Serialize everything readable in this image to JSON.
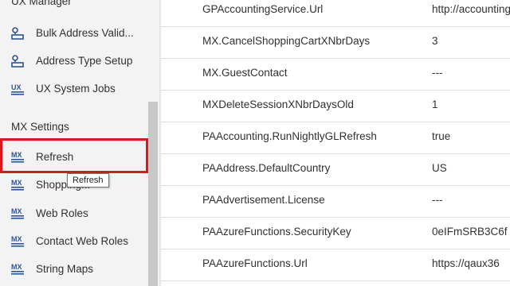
{
  "sidebar": {
    "ux_section_title": "UX Manager",
    "ux_items": [
      {
        "label": "Bulk Address Valid...",
        "icon": "address-icon"
      },
      {
        "label": "Address Type Setup",
        "icon": "address-icon"
      },
      {
        "label": "UX System Jobs",
        "icon": "ux-icon"
      }
    ],
    "mx_section_title": "MX Settings",
    "mx_items": [
      {
        "label": "Refresh",
        "icon": "mx-icon"
      },
      {
        "label": "Shopping...",
        "icon": "mx-icon"
      },
      {
        "label": "Web Roles",
        "icon": "mx-icon"
      },
      {
        "label": "Contact Web Roles",
        "icon": "mx-icon"
      },
      {
        "label": "String Maps",
        "icon": "mx-icon"
      }
    ],
    "tooltip": "Refresh"
  },
  "settings": [
    {
      "name": "GPAccountingService.Url",
      "value": "http://accounting"
    },
    {
      "name": "MX.CancelShoppingCartXNbrDays",
      "value": "3"
    },
    {
      "name": "MX.GuestContact",
      "value": "---"
    },
    {
      "name": "MXDeleteSessionXNbrDaysOld",
      "value": "1"
    },
    {
      "name": "PAAccounting.RunNightlyGLRefresh",
      "value": "true"
    },
    {
      "name": "PAAddress.DefaultCountry",
      "value": "US"
    },
    {
      "name": "PAAdvertisement.License",
      "value": "---"
    },
    {
      "name": "PAAzureFunctions.SecurityKey",
      "value": "0eIFmSRB3C6f"
    },
    {
      "name": "PAAzureFunctions.Url",
      "value": "https://qaux36"
    }
  ],
  "colors": {
    "highlight": "#e0151d",
    "icon_blue": "#2b579a"
  }
}
